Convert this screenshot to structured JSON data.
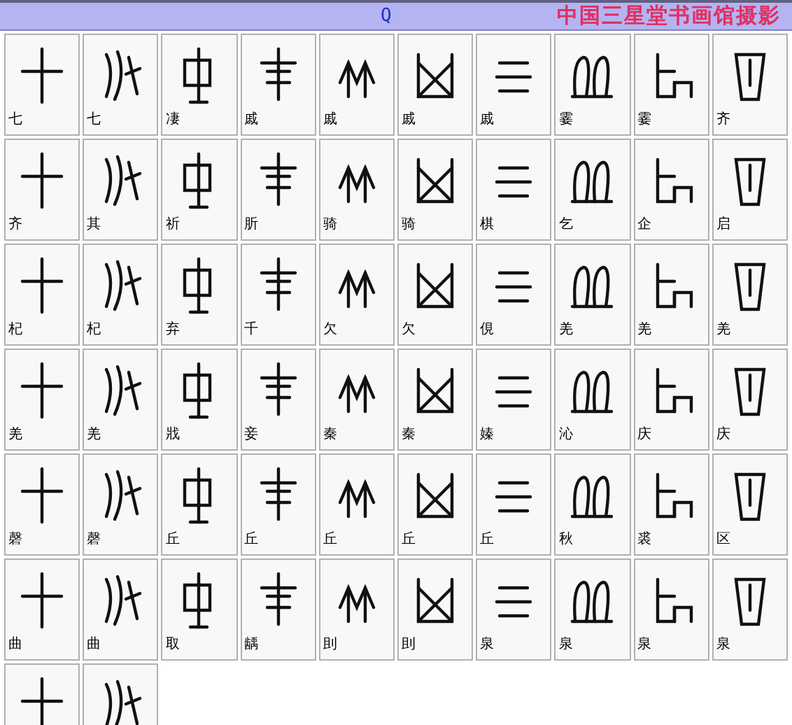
{
  "header": {
    "letter": "Q",
    "title": "中国三星堂书画馆摄影"
  },
  "cells": [
    {
      "label": "七"
    },
    {
      "label": "七"
    },
    {
      "label": "凄"
    },
    {
      "label": "戚"
    },
    {
      "label": "戚"
    },
    {
      "label": "戚"
    },
    {
      "label": "戚"
    },
    {
      "label": "霎"
    },
    {
      "label": "霎"
    },
    {
      "label": "齐"
    },
    {
      "label": "齐"
    },
    {
      "label": "其"
    },
    {
      "label": "祈"
    },
    {
      "label": "肵"
    },
    {
      "label": "骑"
    },
    {
      "label": "骑"
    },
    {
      "label": "棋"
    },
    {
      "label": "乞"
    },
    {
      "label": "企"
    },
    {
      "label": "启"
    },
    {
      "label": "杞"
    },
    {
      "label": "杞"
    },
    {
      "label": "弃"
    },
    {
      "label": "千"
    },
    {
      "label": "欠"
    },
    {
      "label": "欠"
    },
    {
      "label": "俔"
    },
    {
      "label": "羌"
    },
    {
      "label": "羌"
    },
    {
      "label": "羌"
    },
    {
      "label": "羌"
    },
    {
      "label": "羌"
    },
    {
      "label": "戕"
    },
    {
      "label": "妾"
    },
    {
      "label": "秦"
    },
    {
      "label": "秦"
    },
    {
      "label": "嫀"
    },
    {
      "label": "沁"
    },
    {
      "label": "庆"
    },
    {
      "label": "庆"
    },
    {
      "label": "磬"
    },
    {
      "label": "磬"
    },
    {
      "label": "丘"
    },
    {
      "label": "丘"
    },
    {
      "label": "丘"
    },
    {
      "label": "丘"
    },
    {
      "label": "丘"
    },
    {
      "label": "秋"
    },
    {
      "label": "裘"
    },
    {
      "label": "区"
    },
    {
      "label": "曲"
    },
    {
      "label": "曲"
    },
    {
      "label": "取"
    },
    {
      "label": "龋"
    },
    {
      "label": "刞"
    },
    {
      "label": "刞"
    },
    {
      "label": "泉"
    },
    {
      "label": "泉"
    },
    {
      "label": "泉"
    },
    {
      "label": "泉"
    },
    {},
    {}
  ]
}
